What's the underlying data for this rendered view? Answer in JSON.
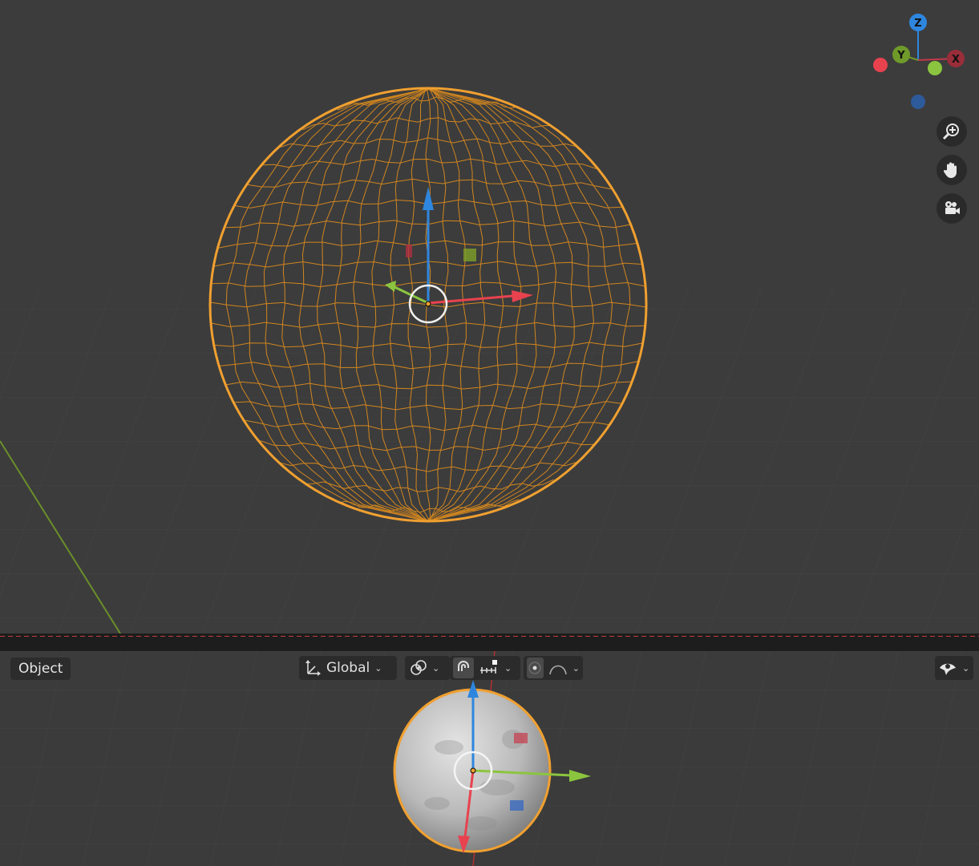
{
  "header": {
    "mode_label": "Object",
    "transform_orientation": "Global"
  },
  "gizmo": {
    "axis_z": "Z",
    "axis_y": "Y",
    "axis_x": "X"
  },
  "colors": {
    "selection_outline": "#f0a030",
    "axis_x": "#e8424f",
    "axis_y": "#8bc53f",
    "axis_z": "#2e86de",
    "viewport_bg": "#3c3c3c"
  },
  "icons": {
    "zoom": "zoom-icon",
    "pan": "hand-icon",
    "camera": "camera-icon",
    "orientation": "transform-orientation-icon",
    "pivot": "pivot-icon",
    "snap": "snap-magnet-icon",
    "snap_target": "snap-increment-icon",
    "proportional": "proportional-editing-icon",
    "falloff": "falloff-curve-icon",
    "visibility": "eye-visibility-icon"
  }
}
